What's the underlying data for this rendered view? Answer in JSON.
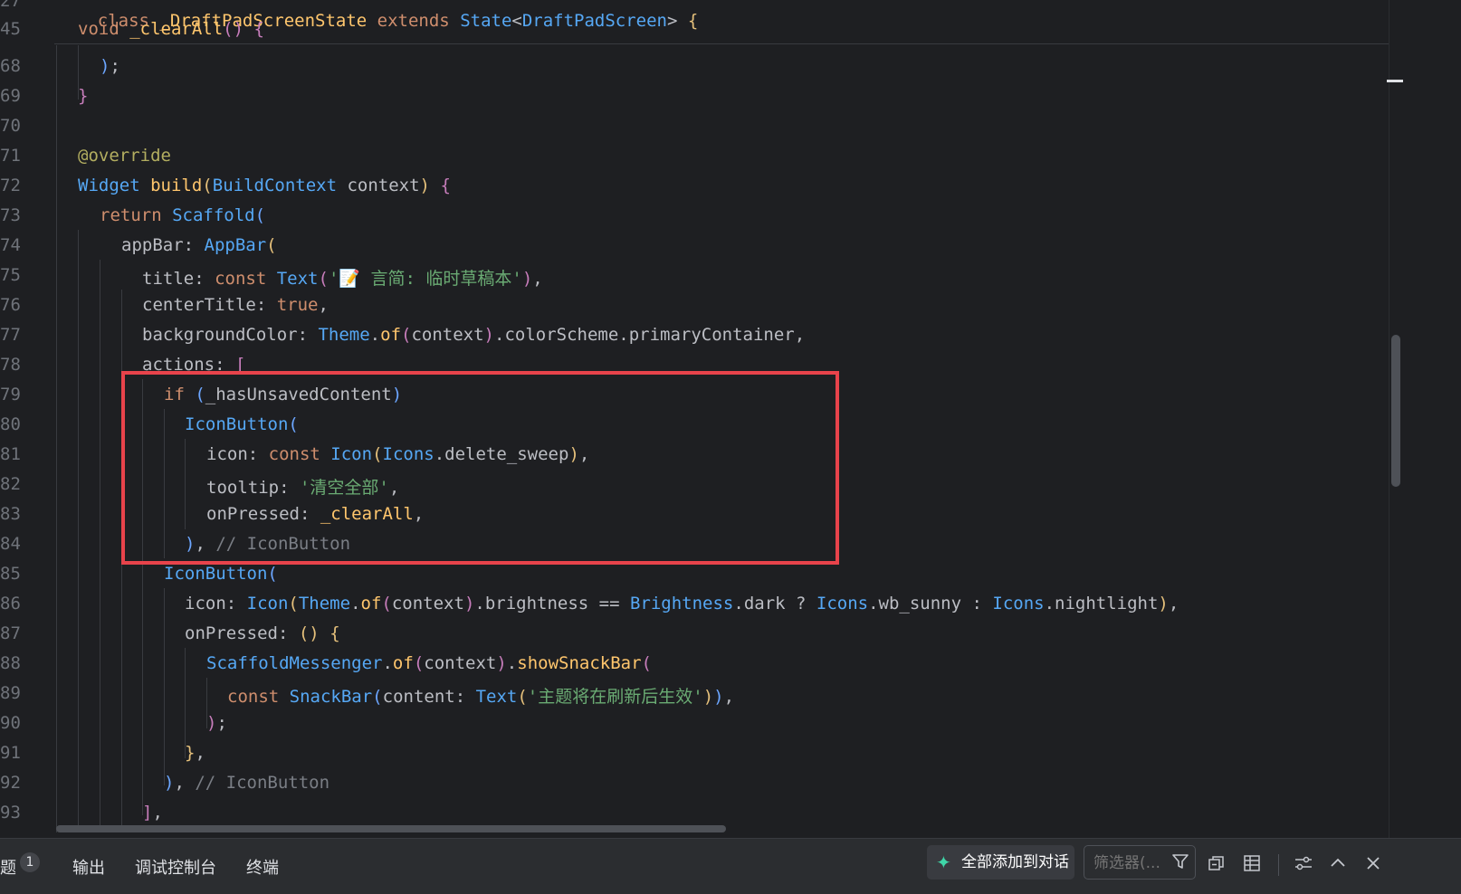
{
  "editor": {
    "sticky_line": {
      "num": "27",
      "text": "class _DraftPadScreenState extends State<DraftPadScreen> {"
    },
    "lines": [
      {
        "num": "45",
        "text": "void _clearAll() {"
      },
      {
        "num": "68",
        "text": ");"
      },
      {
        "num": "69",
        "text": "}"
      },
      {
        "num": "70",
        "text": ""
      },
      {
        "num": "71",
        "text": "@override"
      },
      {
        "num": "72",
        "text": "Widget build(BuildContext context) {"
      },
      {
        "num": "73",
        "text": "return Scaffold("
      },
      {
        "num": "74",
        "text": "appBar: AppBar("
      },
      {
        "num": "75",
        "text": "title: const Text('📝 言简: 临时草稿本'),"
      },
      {
        "num": "76",
        "text": "centerTitle: true,"
      },
      {
        "num": "77",
        "text": "backgroundColor: Theme.of(context).colorScheme.primaryContainer,"
      },
      {
        "num": "78",
        "text": "actions: ["
      },
      {
        "num": "79",
        "text": "if (_hasUnsavedContent)"
      },
      {
        "num": "80",
        "text": "IconButton("
      },
      {
        "num": "81",
        "text": "icon: const Icon(Icons.delete_sweep),"
      },
      {
        "num": "82",
        "text": "tooltip: '清空全部',"
      },
      {
        "num": "83",
        "text": "onPressed: _clearAll,"
      },
      {
        "num": "84",
        "text": "), // IconButton"
      },
      {
        "num": "85",
        "text": "IconButton("
      },
      {
        "num": "86",
        "text": "icon: Icon(Theme.of(context).brightness == Brightness.dark ? Icons.wb_sunny : Icons.nightlight),"
      },
      {
        "num": "87",
        "text": "onPressed: () {"
      },
      {
        "num": "88",
        "text": "ScaffoldMessenger.of(context).showSnackBar("
      },
      {
        "num": "89",
        "text": "const SnackBar(content: Text('主题将在刷新后生效')),"
      },
      {
        "num": "90",
        "text": ");"
      },
      {
        "num": "91",
        "text": "},"
      },
      {
        "num": "92",
        "text": "), // IconButton"
      },
      {
        "num": "93",
        "text": "],"
      }
    ]
  },
  "panel": {
    "tabs": [
      {
        "label": "题",
        "badge": "1"
      },
      {
        "label": "输出"
      },
      {
        "label": "调试控制台"
      },
      {
        "label": "终端"
      }
    ],
    "add_all_label": "全部添加到对话",
    "filter_placeholder": "筛选器(..."
  },
  "colors": {
    "highlight_box": "#e8434b",
    "background": "#1e1f22",
    "panel": "#2b2d30"
  }
}
